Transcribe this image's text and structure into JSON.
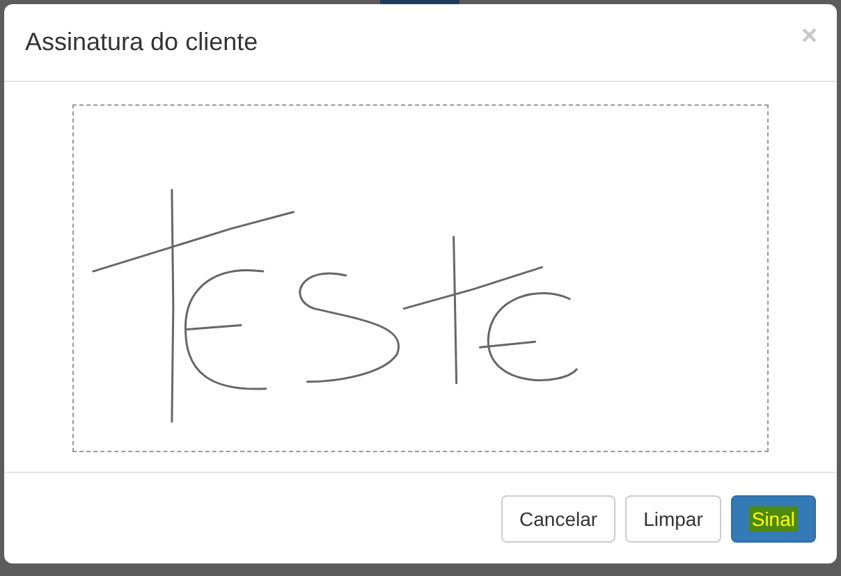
{
  "dialog": {
    "title": "Assinatura do cliente",
    "close": "×"
  },
  "buttons": [
    {
      "label": "Cancelar",
      "kind": "default",
      "highlighted": false
    },
    {
      "label": "Limpar",
      "kind": "default",
      "highlighted": false
    },
    {
      "label": "Sinal",
      "kind": "primary",
      "highlighted": true
    }
  ]
}
